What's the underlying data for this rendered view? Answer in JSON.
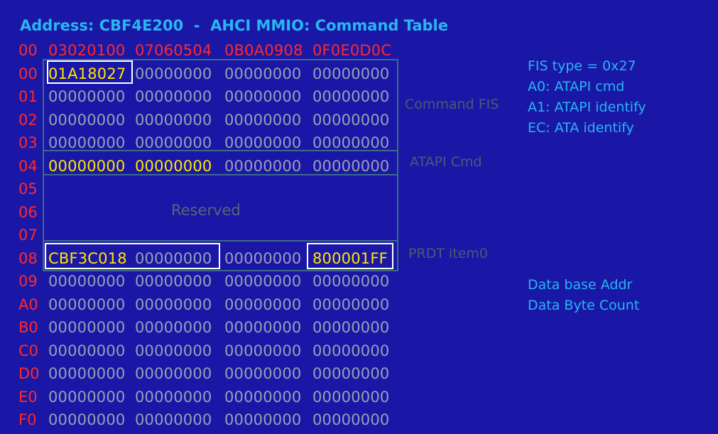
{
  "title": "Address: CBF4E200  -  AHCI MMIO: Command Table",
  "header": {
    "label": "00",
    "cols": [
      "03020100",
      "07060504",
      "0B0A0908",
      "0F0E0D0C"
    ]
  },
  "rows": [
    {
      "label": "00",
      "cols": [
        "01A18027",
        "00000000",
        "00000000",
        "00000000"
      ]
    },
    {
      "label": "01",
      "cols": [
        "00000000",
        "00000000",
        "00000000",
        "00000000"
      ]
    },
    {
      "label": "02",
      "cols": [
        "00000000",
        "00000000",
        "00000000",
        "00000000"
      ]
    },
    {
      "label": "03",
      "cols": [
        "00000000",
        "00000000",
        "00000000",
        "00000000"
      ]
    },
    {
      "label": "04",
      "cols": [
        "00000000",
        "00000000",
        "00000000",
        "00000000"
      ]
    },
    {
      "label": "05"
    },
    {
      "label": "06"
    },
    {
      "label": "07"
    },
    {
      "label": "08",
      "cols": [
        "CBF3C018",
        "00000000",
        "00000000",
        "800001FF"
      ]
    },
    {
      "label": "09",
      "cols": [
        "00000000",
        "00000000",
        "00000000",
        "00000000"
      ]
    },
    {
      "label": "A0",
      "cols": [
        "00000000",
        "00000000",
        "00000000",
        "00000000"
      ]
    },
    {
      "label": "B0",
      "cols": [
        "00000000",
        "00000000",
        "00000000",
        "00000000"
      ]
    },
    {
      "label": "C0",
      "cols": [
        "00000000",
        "00000000",
        "00000000",
        "00000000"
      ]
    },
    {
      "label": "D0",
      "cols": [
        "00000000",
        "00000000",
        "00000000",
        "00000000"
      ]
    },
    {
      "label": "E0",
      "cols": [
        "00000000",
        "00000000",
        "00000000",
        "00000000"
      ]
    },
    {
      "label": "F0",
      "cols": [
        "00000000",
        "00000000",
        "00000000",
        "00000000"
      ]
    }
  ],
  "regions": {
    "command_fis": "Command FIS",
    "atapi_cmd": "ATAPI Cmd",
    "reserved": "Reserved",
    "prdt": "PRDT item0"
  },
  "notes_top": [
    "FIS type = 0x27",
    "A0: ATAPI cmd",
    "A1: ATAPI identify",
    "EC: ATA identify"
  ],
  "notes_bottom": [
    "Data base Addr",
    "Data Byte Count"
  ],
  "colors": {
    "background": "#1a17a6",
    "title": "#27b6f0",
    "row_label": "#ff2a2a",
    "value": "#9aa0b3",
    "highlight": "#ffe600",
    "region_border": "#3d6c86"
  }
}
